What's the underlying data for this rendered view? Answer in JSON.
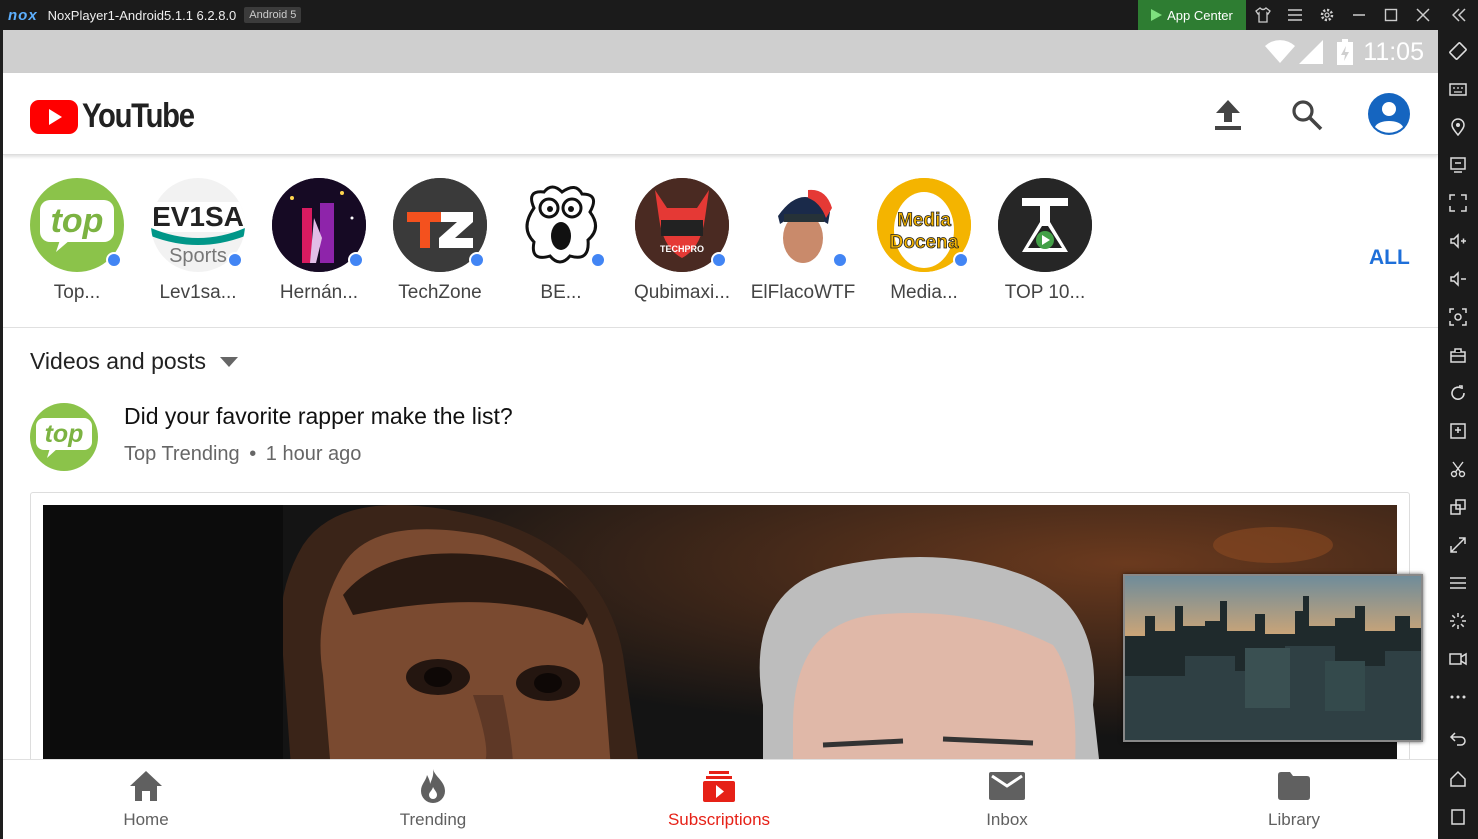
{
  "window": {
    "logo": "nox",
    "title": "NoxPlayer1-Android5.1.1 6.2.8.0",
    "android_badge": "Android 5",
    "app_center": "App Center"
  },
  "status_bar": {
    "time": "11:05"
  },
  "header": {
    "brand": "YouTube"
  },
  "channels": {
    "items": [
      {
        "name": "Top..."
      },
      {
        "name": "Lev1sa..."
      },
      {
        "name": "Hernán..."
      },
      {
        "name": "TechZone"
      },
      {
        "name": "BE..."
      },
      {
        "name": "Qubimaxi..."
      },
      {
        "name": "ElFlacoWTF"
      },
      {
        "name": "Media..."
      },
      {
        "name": "TOP 10..."
      }
    ],
    "all_label": "ALL"
  },
  "feed": {
    "filter_label": "Videos and posts",
    "post": {
      "title": "Did your favorite rapper make the list?",
      "channel": "Top Trending",
      "separator": "•",
      "time": "1 hour ago",
      "avatar_text": "top"
    }
  },
  "bottom_nav": {
    "items": [
      {
        "label": "Home",
        "icon": "home-icon"
      },
      {
        "label": "Trending",
        "icon": "flame-icon"
      },
      {
        "label": "Subscriptions",
        "icon": "subscriptions-icon",
        "active": true
      },
      {
        "label": "Inbox",
        "icon": "mail-icon"
      },
      {
        "label": "Library",
        "icon": "folder-icon"
      }
    ]
  },
  "colors": {
    "brand_red": "#ff0000",
    "active_nav": "#e62117",
    "link_blue": "#1e6fd9",
    "unread_dot": "#4285f4",
    "app_center_green": "#2e7d32"
  }
}
